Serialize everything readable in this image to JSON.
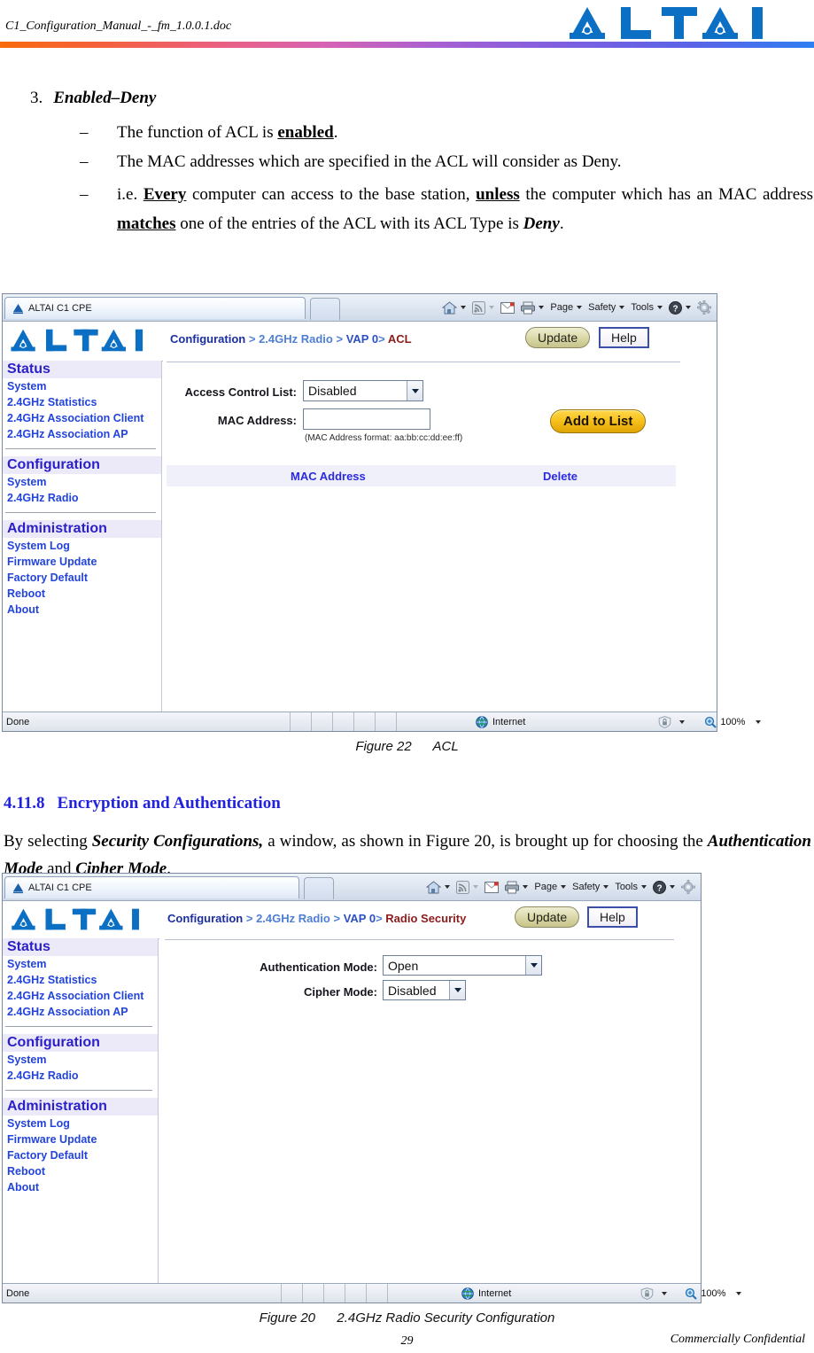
{
  "document": {
    "header_filename": "C1_Configuration_Manual_-_fm_1.0.0.1.doc",
    "brand": "ALTAI",
    "page_number": "29",
    "confidentiality": "Commercially Confidential"
  },
  "list_item": {
    "number": "3.",
    "title": "Enabled–Deny",
    "bullets": [
      {
        "dash": "–",
        "parts": [
          {
            "t": "The function of ACL is ",
            "style": "plain"
          },
          {
            "t": "enabled",
            "style": "ul"
          },
          {
            "t": ".",
            "style": "plain"
          }
        ]
      },
      {
        "dash": "–",
        "parts": [
          {
            "t": "The MAC addresses which are specified in the ACL will consider as Deny.",
            "style": "plain"
          }
        ]
      },
      {
        "dash": "–",
        "parts": [
          {
            "t": "i.e. ",
            "style": "plain"
          },
          {
            "t": "Every",
            "style": "ul"
          },
          {
            "t": " computer can access to the base station, ",
            "style": "plain"
          },
          {
            "t": "unless",
            "style": "ul"
          },
          {
            "t": " the computer which has an MAC address ",
            "style": "plain"
          },
          {
            "t": "matches",
            "style": "ul"
          },
          {
            "t": " one of the entries of the ACL with its ACL Type is ",
            "style": "plain"
          },
          {
            "t": "Deny",
            "style": "bi"
          },
          {
            "t": ".",
            "style": "plain"
          }
        ]
      }
    ]
  },
  "browser_common": {
    "tab_title": "ALTAI C1 CPE",
    "commands": [
      {
        "name": "home-icon",
        "label": "",
        "caret": true
      },
      {
        "name": "rss-feed-icon",
        "label": "",
        "caret": "dim"
      },
      {
        "name": "read-mail-icon",
        "label": "",
        "caret": false
      },
      {
        "name": "print-icon",
        "label": "",
        "caret": true
      },
      {
        "name": "page-menu",
        "label": "Page",
        "caret": true
      },
      {
        "name": "safety-menu",
        "label": "Safety",
        "caret": true
      },
      {
        "name": "tools-menu",
        "label": "Tools",
        "caret": true
      },
      {
        "name": "help-icon",
        "label": "",
        "caret": true
      },
      {
        "name": "settings-gear-icon",
        "label": "",
        "caret": false
      }
    ],
    "update_button": "Update",
    "help_button": "Help",
    "sidebar": [
      {
        "type": "head",
        "label": "Status"
      },
      {
        "type": "link",
        "label": "System"
      },
      {
        "type": "link",
        "label": "2.4GHz Statistics"
      },
      {
        "type": "link",
        "label": "2.4GHz Association Client"
      },
      {
        "type": "link",
        "label": "2.4GHz Association AP"
      },
      {
        "type": "rule",
        "label": ""
      },
      {
        "type": "head",
        "label": "Configuration"
      },
      {
        "type": "link",
        "label": "System"
      },
      {
        "type": "link",
        "label": "2.4GHz Radio"
      },
      {
        "type": "rule",
        "label": ""
      },
      {
        "type": "head",
        "label": "Administration"
      },
      {
        "type": "link",
        "label": "System Log"
      },
      {
        "type": "link",
        "label": "Firmware Update"
      },
      {
        "type": "link",
        "label": "Factory Default"
      },
      {
        "type": "link",
        "label": "Reboot"
      },
      {
        "type": "link",
        "label": "About"
      }
    ],
    "status_bar": {
      "status_text": "Done",
      "zone_label": "Internet",
      "zoom_label": "100%"
    }
  },
  "screenshot_acl": {
    "breadcrumb": {
      "c1": "Configuration",
      "sep1": ">",
      "c2": "2.4GHz Radio",
      "sep2": ">",
      "c3": "VAP 0",
      "sep3": ">",
      "c4": "ACL"
    },
    "fields": {
      "acl_label": "Access Control List:",
      "acl_value": "Disabled",
      "mac_label": "MAC Address:",
      "mac_value": "",
      "mac_hint": "(MAC Address format: aa:bb:cc:dd:ee:ff)",
      "add_button": "Add to List"
    },
    "table": {
      "col_mac": "MAC Address",
      "col_delete": "Delete",
      "rows": []
    },
    "caption_label": "Figure 22",
    "caption_text": "ACL"
  },
  "section": {
    "number": "4.11.8",
    "title": "Encryption and Authentication",
    "paragraph_parts": [
      {
        "t": "By selecting ",
        "style": "plain"
      },
      {
        "t": "Security Configurations,",
        "style": "bi"
      },
      {
        "t": " a window, as shown in Figure 20, is brought up for choosing the ",
        "style": "plain"
      },
      {
        "t": "Authentication Mode",
        "style": "bi"
      },
      {
        "t": " and ",
        "style": "plain"
      },
      {
        "t": "Cipher Mode",
        "style": "bi"
      },
      {
        "t": ".",
        "style": "plain"
      }
    ]
  },
  "screenshot_security": {
    "breadcrumb": {
      "c1": "Configuration",
      "sep1": ">",
      "c2": "2.4GHz Radio",
      "sep2": ">",
      "c3": "VAP 0",
      "sep3": ">",
      "c4": "Radio Security"
    },
    "fields": {
      "auth_label": "Authentication Mode:",
      "auth_value": "Open",
      "cipher_label": "Cipher Mode:",
      "cipher_value": "Disabled"
    },
    "caption_label": "Figure 20",
    "caption_text": "2.4GHz Radio Security Configuration"
  },
  "colors": {
    "brand_blue": "#0b6fc4",
    "link_blue": "#2244dd",
    "heading_blue": "#2222dd",
    "crumb_active": "#8e1b1b",
    "sidebar_head_bg": "#eceaf8",
    "gold_button": "#f7c21d"
  }
}
